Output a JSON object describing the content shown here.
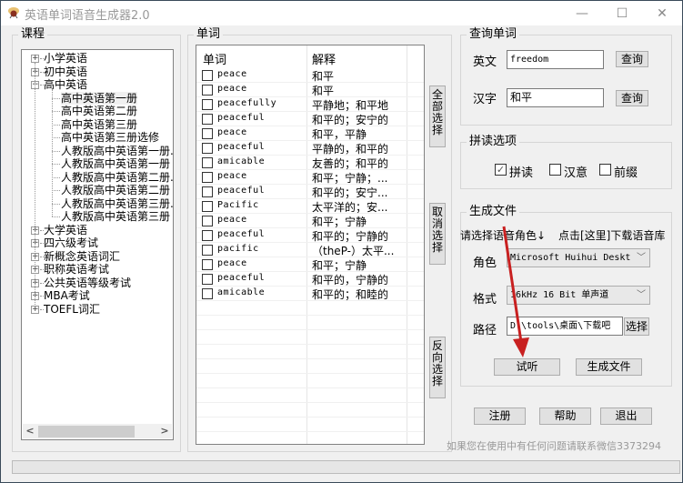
{
  "window": {
    "title": "英语单词语音生成器2.0",
    "minimize": "—",
    "maximize": "☐",
    "close": "✕"
  },
  "course": {
    "title": "课程",
    "items": [
      {
        "label": "小学英语",
        "level": 0,
        "expander": "+"
      },
      {
        "label": "初中英语",
        "level": 0,
        "expander": "+"
      },
      {
        "label": "高中英语",
        "level": 0,
        "expander": "−"
      },
      {
        "label": "高中英语第一册",
        "level": 1,
        "selected": true
      },
      {
        "label": "高中英语第二册",
        "level": 1
      },
      {
        "label": "高中英语第三册",
        "level": 1
      },
      {
        "label": "高中英语第三册选修",
        "level": 1
      },
      {
        "label": "人教版高中英语第一册.",
        "level": 1
      },
      {
        "label": "人教版高中英语第一册",
        "level": 1
      },
      {
        "label": "人教版高中英语第二册.",
        "level": 1
      },
      {
        "label": "人教版高中英语第二册",
        "level": 1
      },
      {
        "label": "人教版高中英语第三册.",
        "level": 1
      },
      {
        "label": "人教版高中英语第三册",
        "level": 1
      },
      {
        "label": "大学英语",
        "level": 0,
        "expander": "+"
      },
      {
        "label": "四六级考试",
        "level": 0,
        "expander": "+"
      },
      {
        "label": "新概念英语词汇",
        "level": 0,
        "expander": "+"
      },
      {
        "label": "职称英语考试",
        "level": 0,
        "expander": "+"
      },
      {
        "label": "公共英语等级考试",
        "level": 0,
        "expander": "+"
      },
      {
        "label": "MBA考试",
        "level": 0,
        "expander": "+"
      },
      {
        "label": "TOEFL词汇",
        "level": 0,
        "expander": "+"
      }
    ],
    "scroll_left": "<",
    "scroll_right": ">"
  },
  "words": {
    "title": "单词",
    "columns": [
      "单词",
      "解释"
    ],
    "rows": [
      {
        "word": "peace",
        "meaning": "和平",
        "checked": false
      },
      {
        "word": "peace",
        "meaning": "和平",
        "checked": false
      },
      {
        "word": "peacefully",
        "meaning": "平静地；和平地",
        "checked": false
      },
      {
        "word": "peaceful",
        "meaning": "和平的；安宁的",
        "checked": false
      },
      {
        "word": "peace",
        "meaning": "和平，平静",
        "checked": false
      },
      {
        "word": "peaceful",
        "meaning": "平静的，和平的",
        "checked": false
      },
      {
        "word": "amicable",
        "meaning": "友善的；和平的",
        "checked": false
      },
      {
        "word": "peace",
        "meaning": "和平；宁静；...",
        "checked": false
      },
      {
        "word": "peaceful",
        "meaning": "和平的；安宁...",
        "checked": false
      },
      {
        "word": "Pacific",
        "meaning": "太平洋的；安...",
        "checked": false
      },
      {
        "word": "peace",
        "meaning": "和平；宁静",
        "checked": false
      },
      {
        "word": "peaceful",
        "meaning": "和平的；宁静的",
        "checked": false
      },
      {
        "word": "pacific",
        "meaning": "（theP-）太平...",
        "checked": false
      },
      {
        "word": "peace",
        "meaning": "和平；宁静",
        "checked": false
      },
      {
        "word": "peaceful",
        "meaning": "和平的，宁静的",
        "checked": false
      },
      {
        "word": "amicable",
        "meaning": "和平的；和睦的",
        "checked": false
      }
    ],
    "select_all": "全部选择",
    "deselect": "取消选择",
    "invert": "反向选择"
  },
  "query": {
    "title": "查询单词",
    "english_label": "英文",
    "english_value": "freedom",
    "chinese_label": "汉字",
    "chinese_value": "和平",
    "query_button": "查询"
  },
  "reading": {
    "title": "拼读选项",
    "options": [
      {
        "label": "拼读",
        "checked": true
      },
      {
        "label": "汉意",
        "checked": false
      },
      {
        "label": "前缀",
        "checked": false
      }
    ]
  },
  "generate": {
    "title": "生成文件",
    "hint_left": "请选择语音角色↓",
    "hint_right": "点击[这里]下载语音库",
    "role_label": "角色",
    "role_value": "Microsoft Huihui Deskt",
    "format_label": "格式",
    "format_value": "16kHz 16 Bit 单声道",
    "path_label": "路径",
    "path_value": "D:\\tools\\桌面\\下载吧",
    "browse_button": "选择",
    "preview_button": "试听",
    "generate_button": "生成文件"
  },
  "footer": {
    "register": "注册",
    "help": "帮助",
    "exit": "退出",
    "contact": "如果您在使用中有任何问题请联系微信3373294"
  }
}
